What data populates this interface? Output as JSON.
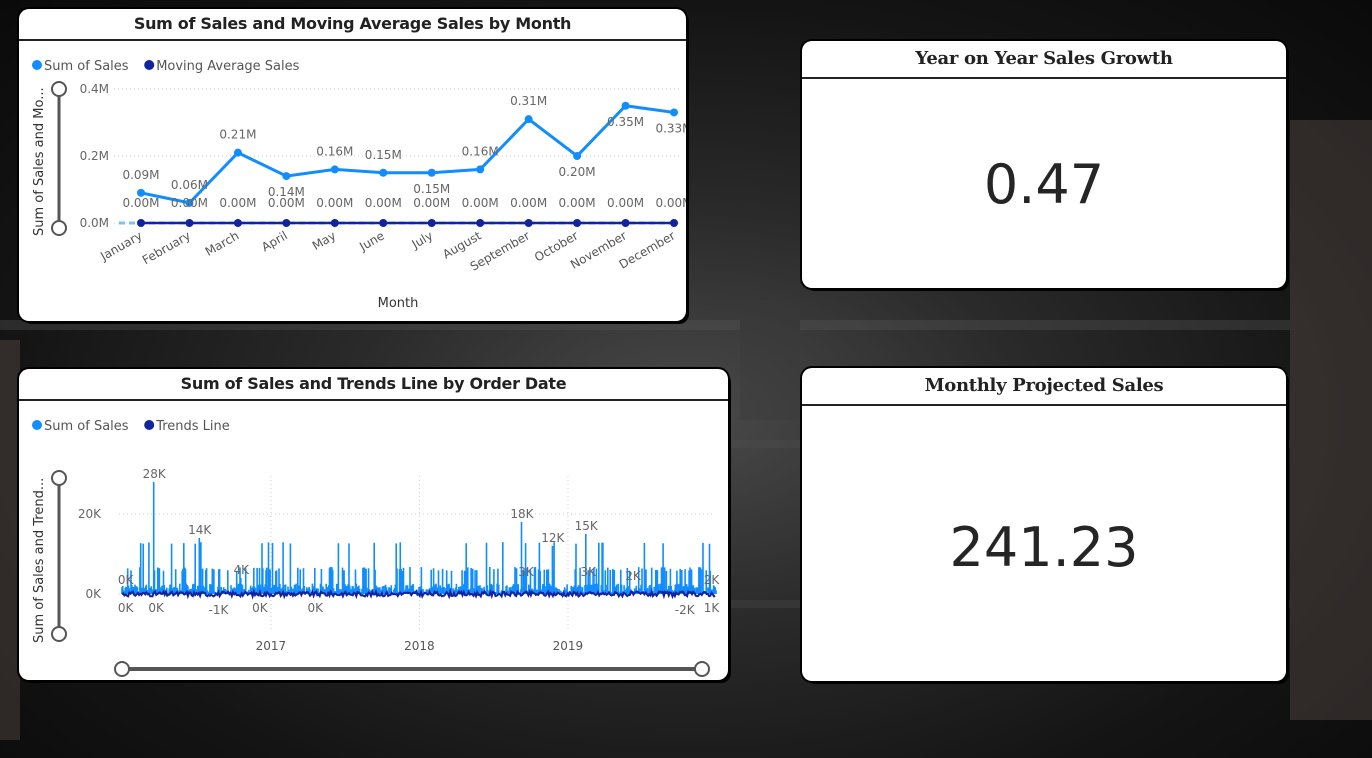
{
  "chart1": {
    "title": "Sum of Sales and Moving Average Sales by Month",
    "legend": [
      {
        "name": "Sum of Sales",
        "color": "#118dff"
      },
      {
        "name": "Moving Average Sales",
        "color": "#12239e"
      }
    ],
    "ylabel": "Sum of Sales and Mo...",
    "xlabel": "Month",
    "yticks": [
      "0.0M",
      "0.2M",
      "0.4M"
    ]
  },
  "chart2": {
    "title": "Sum of Sales and Trends Line by Order Date",
    "legend": [
      {
        "name": "Sum of Sales",
        "color": "#118dff"
      },
      {
        "name": "Trends Line",
        "color": "#12239e"
      }
    ],
    "ylabel": "Sum of Sales and Trend...",
    "xlabel": "Order Date",
    "yticks": [
      "0K",
      "20K"
    ],
    "xticks": [
      "2017",
      "2018",
      "2019"
    ]
  },
  "kpi1": {
    "title": "Year on Year Sales Growth",
    "value": "0.47"
  },
  "kpi2": {
    "title": "Monthly Projected Sales",
    "value": "241.23"
  },
  "chart_data": [
    {
      "type": "line",
      "title": "Sum of Sales and Moving Average Sales by Month",
      "xlabel": "Month",
      "ylabel": "Sum of Sales and Mo...",
      "ylim": [
        0,
        0.4
      ],
      "categories": [
        "January",
        "February",
        "March",
        "April",
        "May",
        "June",
        "July",
        "August",
        "September",
        "October",
        "November",
        "December"
      ],
      "series": [
        {
          "name": "Sum of Sales",
          "values": [
            0.09,
            0.06,
            0.21,
            0.14,
            0.16,
            0.15,
            0.15,
            0.16,
            0.31,
            0.2,
            0.35,
            0.33
          ],
          "labels": [
            "0.09M",
            "0.06M",
            "0.21M",
            "0.14M",
            "0.16M",
            "0.15M",
            "0.15M",
            "0.16M",
            "0.31M",
            "0.20M",
            "0.35M",
            "0.33M"
          ]
        },
        {
          "name": "Moving Average Sales",
          "values": [
            0,
            0,
            0,
            0,
            0,
            0,
            0,
            0,
            0,
            0,
            0,
            0
          ],
          "labels": [
            "0.00M",
            "0.00M",
            "0.00M",
            "0.00M",
            "0.00M",
            "0.00M",
            "0.00M",
            "0.00M",
            "0.00M",
            "0.00M",
            "0.00M",
            "0.00M"
          ]
        }
      ],
      "grid": true,
      "legend_position": "top-left"
    },
    {
      "type": "line",
      "title": "Sum of Sales and Trends Line by Order Date",
      "xlabel": "Order Date",
      "ylabel": "Sum of Sales and Trend...",
      "ylim": [
        -3,
        30
      ],
      "xlim": [
        "2016-01-01",
        "2019-12-31"
      ],
      "xticks": [
        "2017",
        "2018",
        "2019"
      ],
      "series": [
        {
          "name": "Sum of Sales"
        },
        {
          "name": "Trends Line"
        }
      ],
      "annotations": [
        {
          "x": "2016-03-20",
          "y": 28,
          "label": "28K"
        },
        {
          "x": "2016-07-10",
          "y": 14,
          "label": "14K"
        },
        {
          "x": "2016-10-20",
          "y": 4,
          "label": "4K"
        },
        {
          "x": "2018-09-10",
          "y": 18,
          "label": "18K"
        },
        {
          "x": "2018-11-25",
          "y": 12,
          "label": "12K"
        },
        {
          "x": "2019-02-15",
          "y": 15,
          "label": "15K"
        },
        {
          "x": "2016-01-10",
          "y": 0,
          "label": "0K"
        },
        {
          "x": "2016-01-10",
          "y": -0.5,
          "label": "0K"
        },
        {
          "x": "2016-03-25",
          "y": -0.5,
          "label": "0K"
        },
        {
          "x": "2016-08-25",
          "y": -1,
          "label": "-1K"
        },
        {
          "x": "2016-12-05",
          "y": -0.5,
          "label": "0K"
        },
        {
          "x": "2017-04-20",
          "y": -0.5,
          "label": "0K"
        },
        {
          "x": "2018-09-20",
          "y": 3,
          "label": "3K"
        },
        {
          "x": "2019-02-20",
          "y": 3,
          "label": "3K"
        },
        {
          "x": "2019-06-10",
          "y": 2,
          "label": "2K"
        },
        {
          "x": "2019-10-15",
          "y": -2,
          "label": "-2K"
        },
        {
          "x": "2019-12-20",
          "y": 1,
          "label": "1K"
        },
        {
          "x": "2019-12-20",
          "y": 2,
          "label": "2K"
        }
      ],
      "grid": true,
      "legend_position": "top-left"
    }
  ]
}
